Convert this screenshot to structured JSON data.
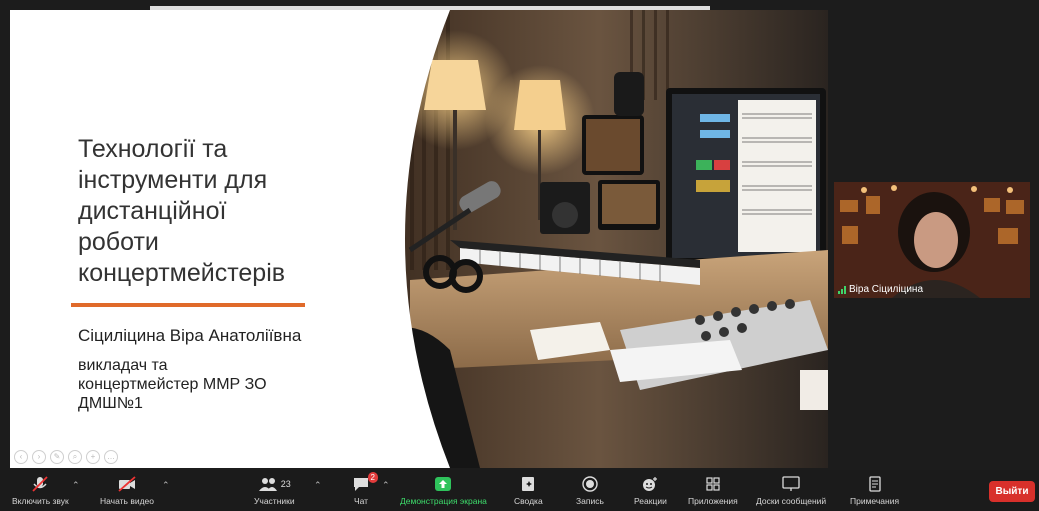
{
  "slide": {
    "title_lines": [
      "Технології та",
      "інструменти для",
      "дистанційної",
      "роботи",
      "концертмейстерів"
    ],
    "author": "Сіциліцина Віра Анатоліївна",
    "role_lines": [
      "викладач та",
      "концертмейстер ММР ЗО",
      "ДМШ№1"
    ],
    "accent_color": "#e06a2a"
  },
  "video_tile": {
    "name": "Віра Сіциліцина"
  },
  "toolbar": {
    "audio": "Включить звук",
    "video": "Начать видео",
    "participants": "Участники",
    "participants_count": "23",
    "chat": "Чат",
    "chat_badge": "2",
    "share": "Демонстрация экрана",
    "summary": "Сводка",
    "record": "Запись",
    "reactions": "Реакции",
    "apps": "Приложения",
    "whiteboards": "Доски сообщений",
    "notes": "Примечания",
    "leave": "Выйти"
  }
}
